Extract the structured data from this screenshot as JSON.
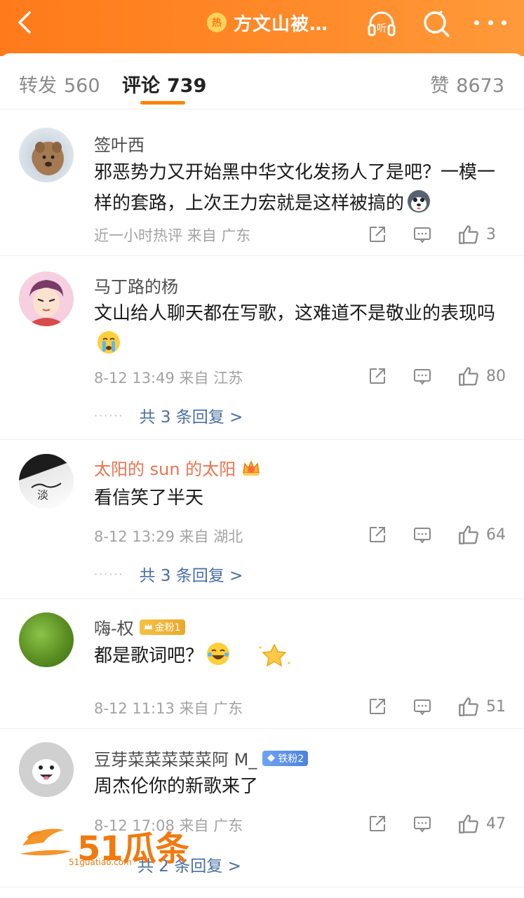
{
  "header": {
    "title": "方文山被…",
    "hot_badge": "热",
    "listen_label": "听",
    "bg_color": "#ff8200"
  },
  "tabs": {
    "repost_label": "转发",
    "repost_count": "560",
    "comment_label": "评论",
    "comment_count": "739",
    "like_label": "赞",
    "like_count": "8673"
  },
  "comments": [
    {
      "name": "签叶西",
      "text": "邪恶势力又开始黑中华文化发扬人了是吧？一模一样的套路，上次王力宏就是这样被搞的",
      "emoji": "husky-icon",
      "meta": "近一小时热评  来自 广东",
      "likes": "3"
    },
    {
      "name": "马丁路的杨",
      "text": "文山给人聊天都在写歌，这难道不是敬业的表现吗",
      "emoji": "crying-face-icon",
      "meta": "8-12 13:49  来自 江苏",
      "likes": "80",
      "replies": "共 3 条回复 >"
    },
    {
      "name": "太阳的 sun 的太阳",
      "text": "看信笑了半天",
      "meta": "8-12 13:29  来自 湖北",
      "likes": "64",
      "replies": "共 3 条回复 >"
    },
    {
      "name": "嗨-权",
      "badge": "金粉1",
      "text": "都是歌词吧？",
      "emoji": "laughing-tears-icon",
      "meta": "8-12 11:13  来自 广东",
      "likes": "51"
    },
    {
      "name": "豆芽菜菜菜菜菜阿 M_",
      "badge": "铁粉2",
      "text": "周杰伦你的新歌来了",
      "meta": "8-12 17:08  来自 广东",
      "likes": "47",
      "replies": "共 2 条回复 >"
    }
  ],
  "watermark": {
    "brand": "51瓜条",
    "url": "51guatiao.com"
  }
}
